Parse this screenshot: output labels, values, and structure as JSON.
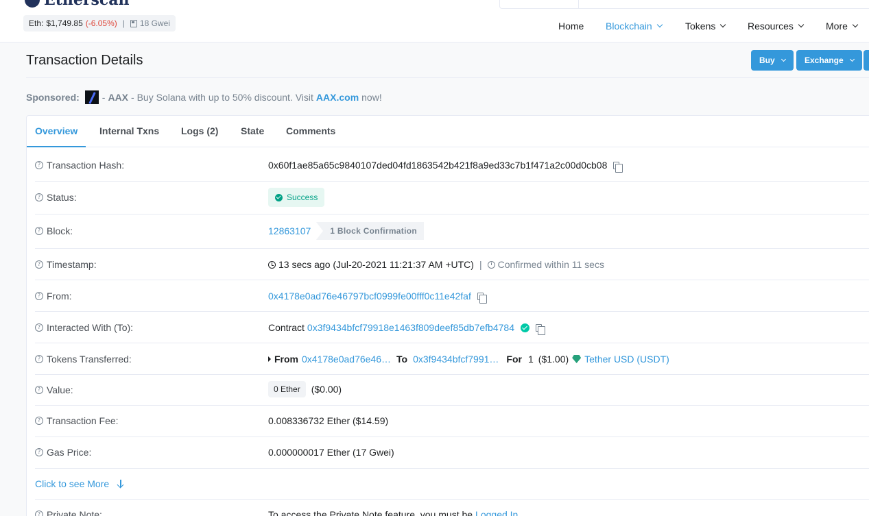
{
  "header": {
    "logo_text": "Etherscan",
    "eth_label": "Eth:",
    "eth_price": "$1,749.85",
    "eth_change": "(-6.05%)",
    "separator": "|",
    "gas": "18 Gwei",
    "nav": [
      {
        "label": "Home"
      },
      {
        "label": "Blockchain"
      },
      {
        "label": "Tokens"
      },
      {
        "label": "Resources"
      },
      {
        "label": "More"
      }
    ]
  },
  "page": {
    "title": "Transaction Details",
    "buttons": {
      "buy": "Buy",
      "exchange": "Exchange"
    }
  },
  "sponsored": {
    "label": "Sponsored:",
    "dash": "-",
    "brand": "AAX",
    "text": "- Buy Solana with up to 50% discount. Visit",
    "link": "AAX.com",
    "suffix": "now!"
  },
  "tabs": [
    {
      "label": "Overview"
    },
    {
      "label": "Internal Txns"
    },
    {
      "label": "Logs (2)"
    },
    {
      "label": "State"
    },
    {
      "label": "Comments"
    }
  ],
  "details": {
    "tx_hash": {
      "label": "Transaction Hash:",
      "value": "0x60f1ae85a65c9840107ded04fd1863542b421f8a9ed33c7b1f471a2c00d0cb08"
    },
    "status": {
      "label": "Status:",
      "value": "Success"
    },
    "block": {
      "label": "Block:",
      "value": "12863107",
      "confirmations": "1 Block Confirmation"
    },
    "timestamp": {
      "label": "Timestamp:",
      "value": "13 secs ago (Jul-20-2021 11:21:37 AM +UTC)",
      "separator": "|",
      "confirmed": "Confirmed within 11 secs"
    },
    "from": {
      "label": "From:",
      "value": "0x4178e0ad76e46797bcf0999fe00fff0c11e42faf"
    },
    "to": {
      "label": "Interacted With (To):",
      "prefix": "Contract",
      "value": "0x3f9434bfcf79918e1463f809deef85db7efb4784"
    },
    "tokens": {
      "label": "Tokens Transferred:",
      "from_label": "From",
      "from": "0x4178e0ad76e46…",
      "to_label": "To",
      "to": "0x3f9434bfcf7991…",
      "for_label": "For",
      "amount": "1",
      "usd": "($1.00)",
      "token": "Tether USD (USDT)"
    },
    "value": {
      "label": "Value:",
      "ether": "0 Ether",
      "usd": "($0.00)"
    },
    "fee": {
      "label": "Transaction Fee:",
      "value": "0.008336732 Ether ($14.59)"
    },
    "gas_price": {
      "label": "Gas Price:",
      "value": "0.000000017 Ether (17 Gwei)"
    },
    "see_more": "Click to see More",
    "private_note": {
      "label": "Private Note:",
      "text": "To access the Private Note feature, you must be",
      "link": "Logged In"
    }
  },
  "colors": {
    "accent": "#3498db",
    "success": "#00a186",
    "negative": "#de4437",
    "tether": "#26a17b"
  }
}
